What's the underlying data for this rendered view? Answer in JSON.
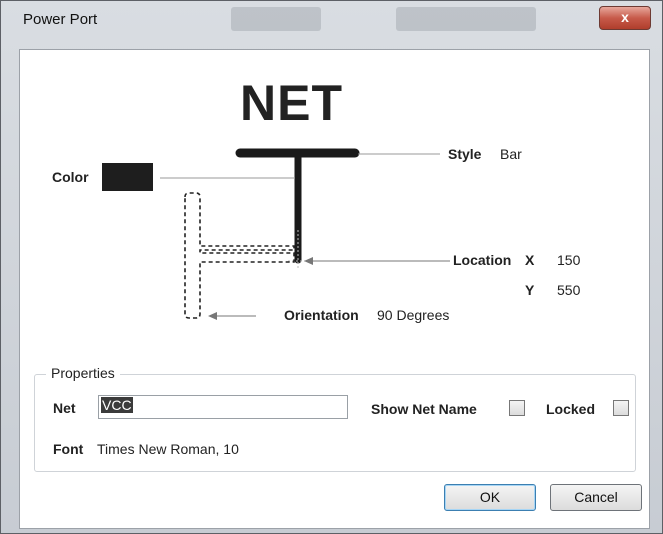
{
  "window": {
    "title": "Power Port",
    "close_glyph": "x"
  },
  "diagram": {
    "net_text": "NET",
    "color_label": "Color",
    "color_value": "#1e1e1e",
    "style_label": "Style",
    "style_value": "Bar",
    "location_label": "Location",
    "x_label": "X",
    "x_value": "150",
    "y_label": "Y",
    "y_value": "550",
    "orientation_label": "Orientation",
    "orientation_value": "90 Degrees"
  },
  "properties": {
    "legend": "Properties",
    "net_label": "Net",
    "net_value": "VCC",
    "show_net_name_label": "Show Net Name",
    "show_net_name_checked": false,
    "locked_label": "Locked",
    "locked_checked": false,
    "font_label": "Font",
    "font_value": "Times New Roman, 10"
  },
  "buttons": {
    "ok": "OK",
    "cancel": "Cancel"
  }
}
